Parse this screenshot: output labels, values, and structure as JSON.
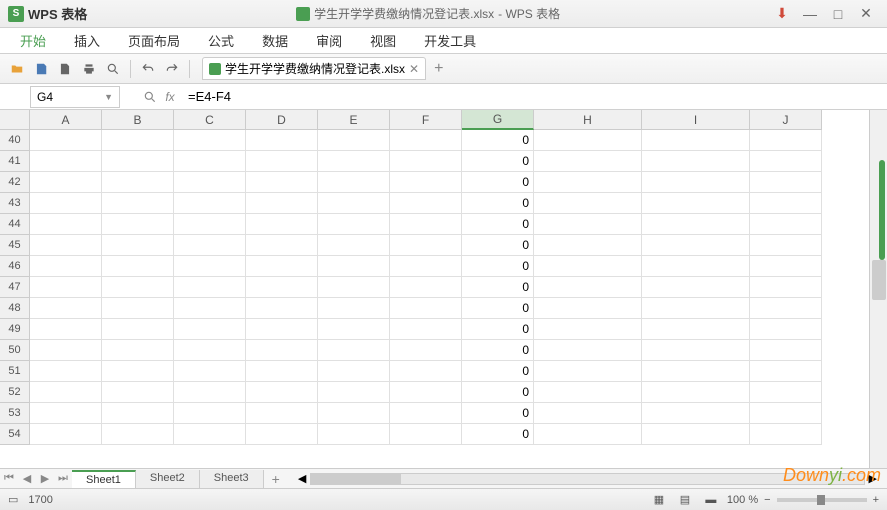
{
  "title": {
    "app_name": "WPS 表格",
    "doc_name": "学生开学学费缴纳情况登记表.xlsx",
    "suffix": " - WPS 表格"
  },
  "menu": {
    "items": [
      "开始",
      "插入",
      "页面布局",
      "公式",
      "数据",
      "审阅",
      "视图",
      "开发工具"
    ]
  },
  "doc_tab": {
    "label": "学生开学学费缴纳情况登记表.xlsx"
  },
  "formula": {
    "cell_ref": "G4",
    "fx": "fx",
    "value": "=E4-F4"
  },
  "columns": [
    {
      "label": "A",
      "w": 72
    },
    {
      "label": "B",
      "w": 72
    },
    {
      "label": "C",
      "w": 72
    },
    {
      "label": "D",
      "w": 72
    },
    {
      "label": "E",
      "w": 72
    },
    {
      "label": "F",
      "w": 72
    },
    {
      "label": "G",
      "w": 72
    },
    {
      "label": "H",
      "w": 108
    },
    {
      "label": "I",
      "w": 108
    },
    {
      "label": "J",
      "w": 72
    }
  ],
  "selected_col": "G",
  "rows": [
    40,
    41,
    42,
    43,
    44,
    45,
    46,
    47,
    48,
    49,
    50,
    51,
    52,
    53,
    54
  ],
  "cell_value": "0",
  "sheets": {
    "tabs": [
      "Sheet1",
      "Sheet2",
      "Sheet3"
    ],
    "active": 0
  },
  "status": {
    "count": "1700",
    "zoom": "100 %"
  },
  "watermark": {
    "t1": "Down",
    "t2": "yi",
    "t3": ".com"
  }
}
